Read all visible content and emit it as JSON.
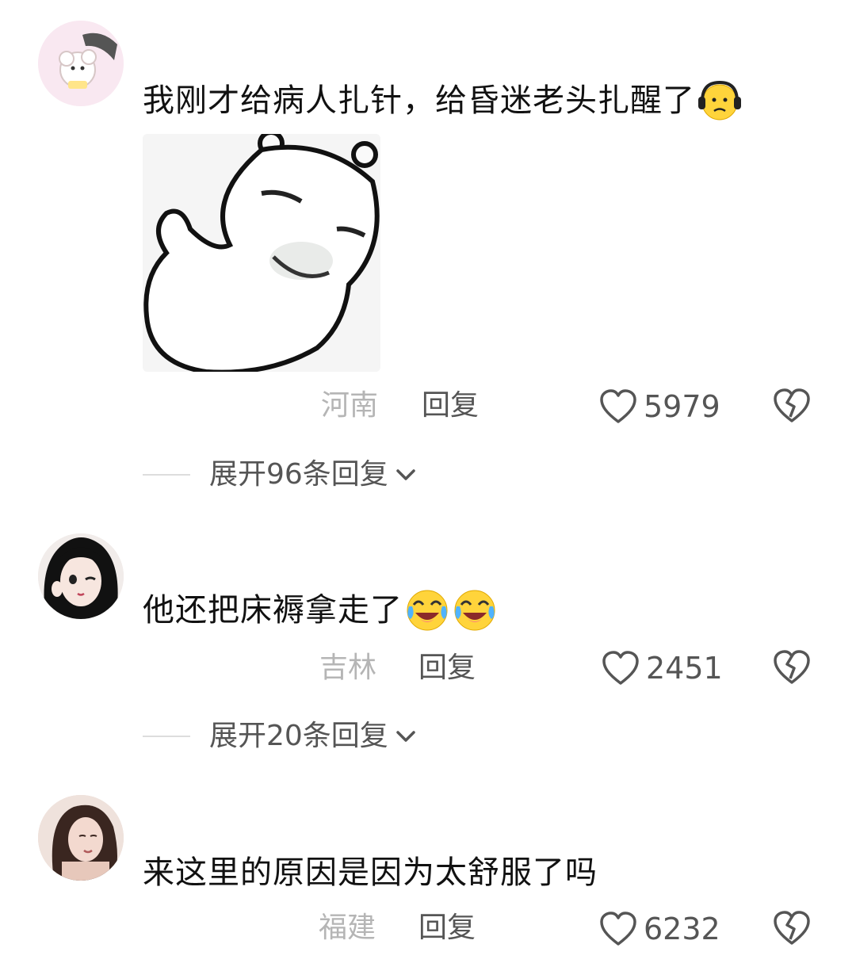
{
  "comments": [
    {
      "text": "我刚才给病人扎针，给昏迷老头扎醒了",
      "emoji": [
        "neutral-face-headphones-emoji"
      ],
      "location": "河南",
      "reply_label": "回复",
      "likes": "5979",
      "expand_label": "展开96条回复",
      "image": "meme-sticker"
    },
    {
      "text": "他还把床褥拿走了",
      "emoji": [
        "crying-laughing-emoji",
        "crying-laughing-emoji"
      ],
      "location": "吉林",
      "reply_label": "回复",
      "likes": "2451",
      "expand_label": "展开20条回复"
    },
    {
      "text": "来这里的原因是因为太舒服了吗",
      "emoji": [],
      "location": "福建",
      "reply_label": "回复",
      "likes": "6232"
    }
  ],
  "icons": {
    "like": "heart-outline-icon",
    "dislike": "broken-heart-icon",
    "expand": "chevron-down-icon"
  },
  "colors": {
    "text": "#111111",
    "meta": "#b5b5b5",
    "action": "#555555",
    "emoji_yellow": "#ffd43b"
  }
}
